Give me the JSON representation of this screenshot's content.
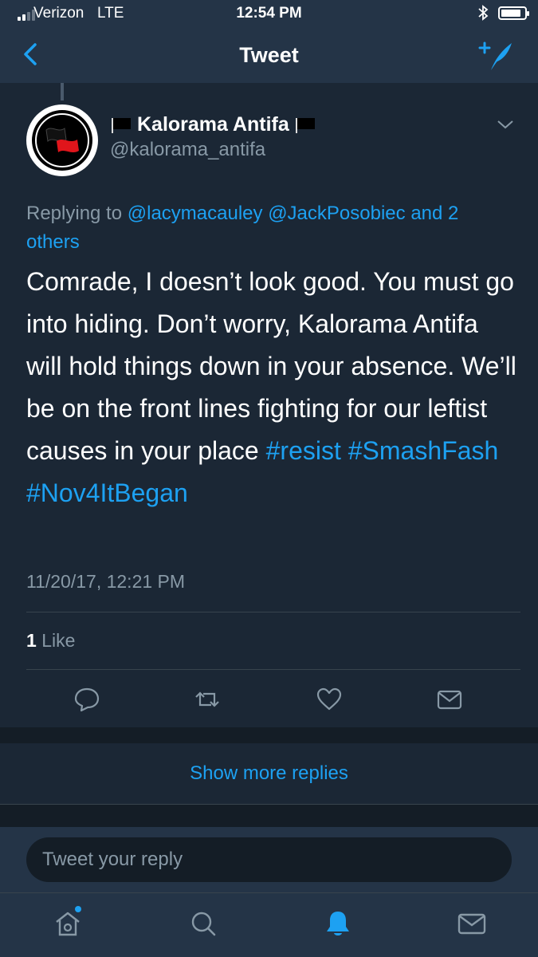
{
  "status_bar": {
    "carrier": "Verizon",
    "network": "LTE",
    "time": "12:54 PM",
    "signal_bars": 2,
    "battery_level": 0.85
  },
  "nav": {
    "title": "Tweet",
    "back_icon": "chevron-left-icon",
    "compose_icon": "compose-tweet-icon"
  },
  "tweet": {
    "display_name": "Kalorama Antifa",
    "handle": "@kalorama_antifa",
    "avatar_icon": "antifa-flag-avatar",
    "replying_prefix": "Replying to ",
    "replying_mention_1": "@lacymacauley",
    "replying_mention_2": "@JackPosobiec",
    "replying_and_others": "and 2 others",
    "text_plain": "Comrade, I doesn’t look good. You must go into hiding. Don’t worry, Kalorama Antifa will hold things down in your absence. We’ll be on the front lines fighting for our leftist causes in your place ",
    "hashtag_1": "#resist",
    "hashtag_2": "#SmashFash",
    "hashtag_3": "#Nov4ItBegan",
    "timestamp": "11/20/17, 12:21 PM",
    "like_count": "1",
    "like_label": "Like"
  },
  "show_more_replies": "Show more replies",
  "reply_bar": {
    "placeholder": "Tweet your reply"
  },
  "colors": {
    "accent": "#1da1f2",
    "background": "#1b2735",
    "header": "#243447",
    "muted_text": "#8899a6"
  }
}
